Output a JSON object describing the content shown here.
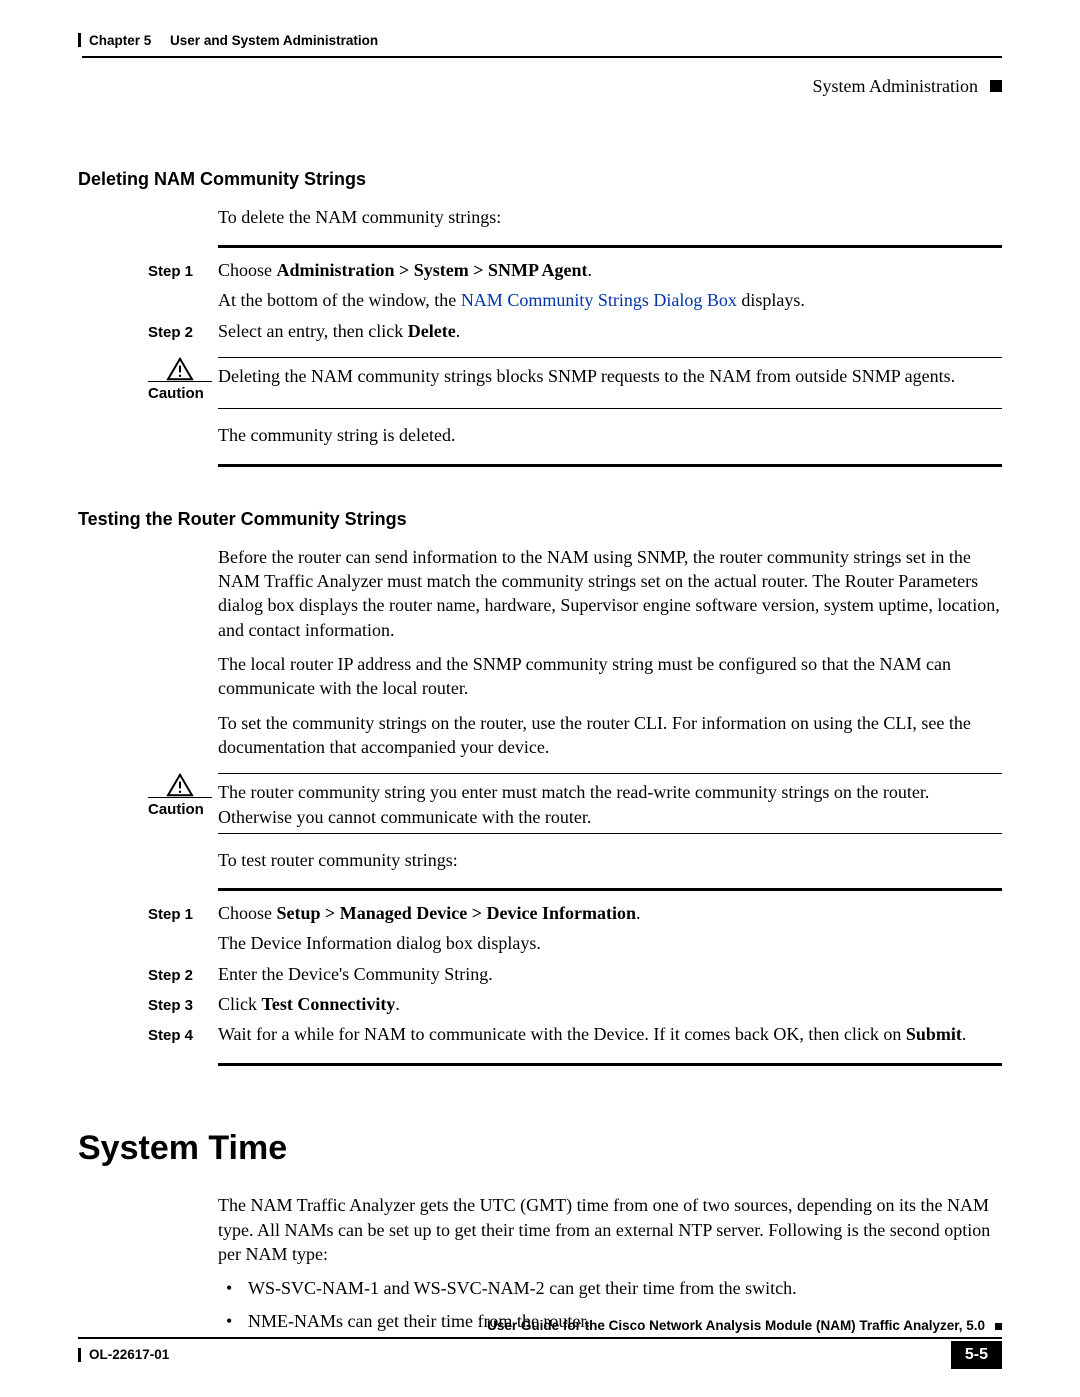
{
  "header": {
    "chapter": "Chapter 5",
    "chapter_title": "User and System Administration",
    "breadcrumb": "System Administration"
  },
  "sections": {
    "delete": {
      "title": "Deleting NAM Community Strings",
      "intro": "To delete the NAM community strings:",
      "step1_label": "Step 1",
      "step1_a": "Choose ",
      "step1_b": "Administration > System > SNMP Agent",
      "step1_c": ".",
      "step1_d": "At the bottom of the window, the ",
      "step1_link": "NAM Community Strings Dialog Box",
      "step1_e": " displays.",
      "step2_label": "Step 2",
      "step2_a": "Select an entry, then click ",
      "step2_b": "Delete",
      "step2_c": ".",
      "caution_label": "Caution",
      "caution_text": "Deleting the NAM community strings blocks SNMP requests to the NAM from outside SNMP agents.",
      "after": "The community string is deleted."
    },
    "test": {
      "title": "Testing the Router Community Strings",
      "p1": "Before the router can send information to the NAM using SNMP, the router community strings set in the NAM Traffic Analyzer must match the community strings set on the actual router. The Router Parameters dialog box displays the router name, hardware, Supervisor engine software version, system uptime, location, and contact information.",
      "p2": "The local router IP address and the SNMP community string must be configured so that the NAM can communicate with the local router.",
      "p3": "To set the community strings on the router, use the router CLI. For information on using the CLI, see the documentation that accompanied your device.",
      "caution_label": "Caution",
      "caution_text": "The router community string you enter must match the read-write community strings on the router. Otherwise you cannot communicate with the router.",
      "intro2": "To test router community strings:",
      "step1_label": "Step 1",
      "step1_a": "Choose ",
      "step1_b": "Setup > Managed Device > Device Information",
      "step1_c": ".",
      "step1_d": "The Device Information dialog box displays.",
      "step2_label": "Step 2",
      "step2_text": "Enter the Device's Community String.",
      "step3_label": "Step 3",
      "step3_a": "Click ",
      "step3_b": "Test Connectivity",
      "step3_c": ".",
      "step4_label": "Step 4",
      "step4_a": "Wait for a while for NAM to communicate with the Device. If it comes back OK, then click on ",
      "step4_b": "Submit",
      "step4_c": "."
    },
    "systime": {
      "title": "System Time",
      "p1": "The NAM Traffic Analyzer gets the UTC (GMT) time from one of two sources, depending on its the NAM type. All NAMs can be set up to get their time from an external NTP server. Following is the second option per NAM type:",
      "bullets": [
        "WS-SVC-NAM-1 and WS-SVC-NAM-2 can get their time from the switch.",
        "NME-NAMs can get their time from the router."
      ]
    }
  },
  "footer": {
    "guide": "User Guide for the Cisco Network Analysis Module (NAM) Traffic Analyzer, 5.0",
    "docnum": "OL-22617-01",
    "pagenum": "5-5"
  }
}
